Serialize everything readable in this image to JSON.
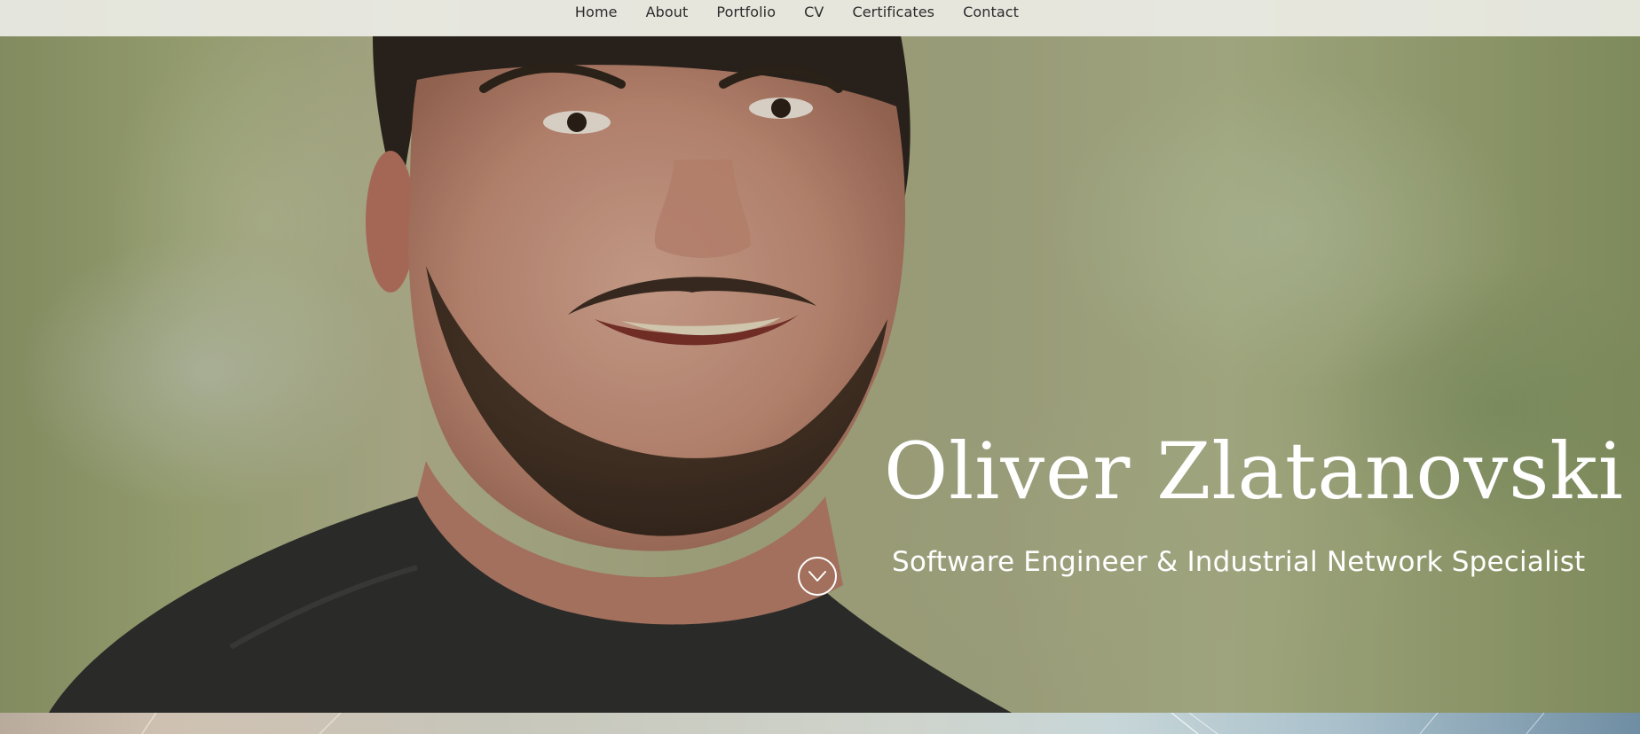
{
  "nav": {
    "items": [
      {
        "label": "Home"
      },
      {
        "label": "About"
      },
      {
        "label": "Portfolio"
      },
      {
        "label": "CV"
      },
      {
        "label": "Certificates"
      },
      {
        "label": "Contact"
      }
    ]
  },
  "hero": {
    "name": "Oliver Zlatanovski",
    "subtitle": "Software Engineer & Industrial Network Specialist",
    "scroll_icon": "chevron-down-icon"
  },
  "colors": {
    "nav_bg": "#ecece5",
    "nav_text": "#2b2b2b",
    "hero_text": "#ffffff"
  }
}
